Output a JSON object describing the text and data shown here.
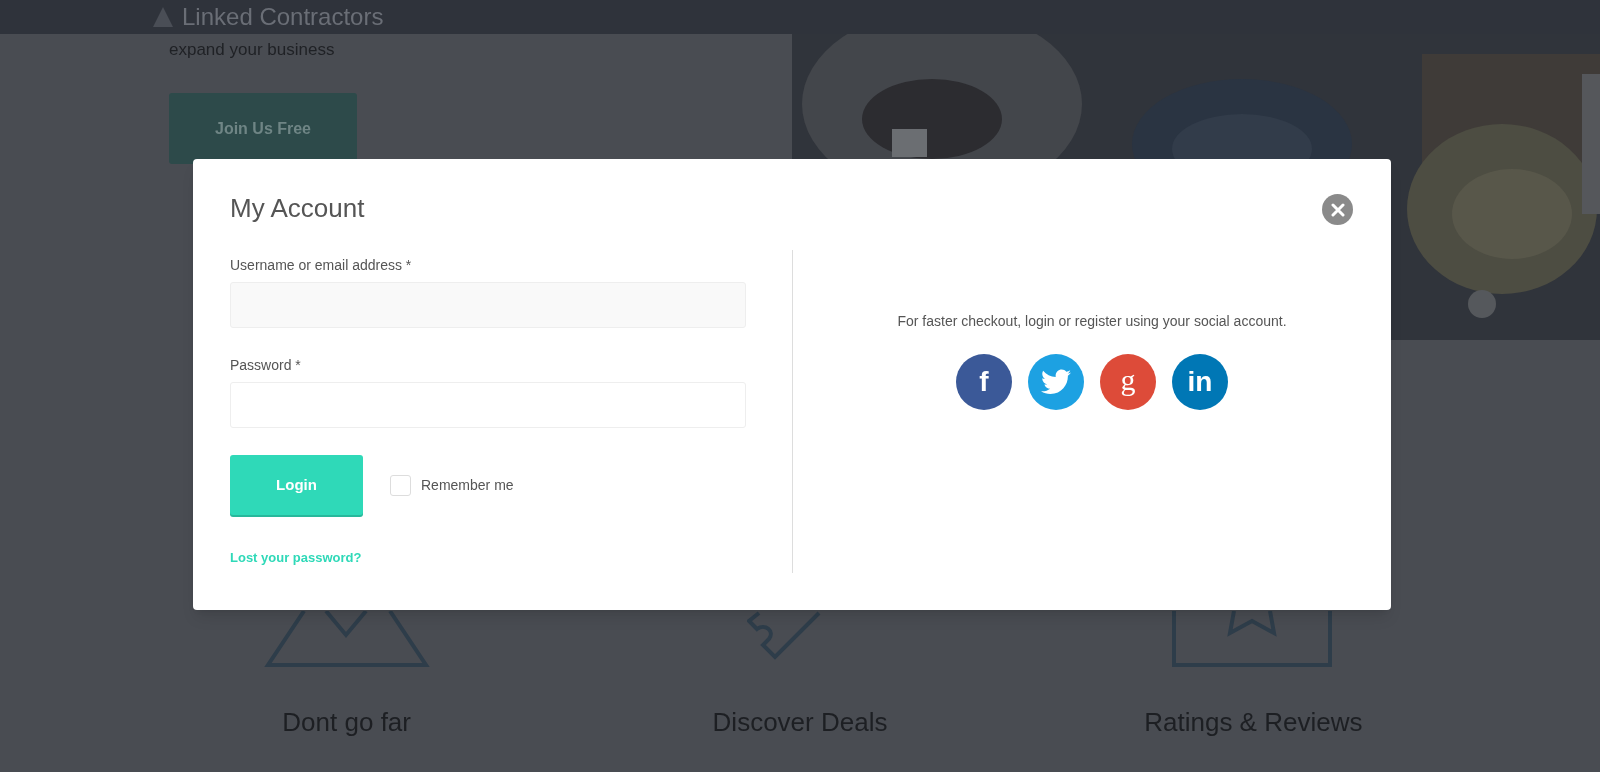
{
  "header": {
    "logo_text": "Linked Contractors"
  },
  "hero": {
    "tagline": "expand your business",
    "button": "Join Us Free"
  },
  "features": [
    {
      "kind": "mountain",
      "title": "Dont go far"
    },
    {
      "kind": "tag",
      "title": "Discover Deals"
    },
    {
      "kind": "star",
      "title": "Ratings & Reviews"
    }
  ],
  "modal": {
    "title": "My Account",
    "fields": [
      {
        "label": "Username or email address *"
      },
      {
        "label": "Password *"
      }
    ],
    "login_button": "Login",
    "remember": {
      "label": "Remember me",
      "checked": false
    },
    "lost_password_link": "Lost your password?",
    "social_text": "For faster checkout, login or register using your social account.",
    "social_buttons": [
      {
        "kind": "facebook",
        "glyph": "f",
        "color": "#3b5998"
      },
      {
        "kind": "twitter",
        "color": "#1da1e2"
      },
      {
        "kind": "google",
        "glyph": "g",
        "color": "#dd4b39"
      },
      {
        "kind": "linkedin",
        "glyph": "in",
        "color": "#0077b5"
      }
    ]
  }
}
